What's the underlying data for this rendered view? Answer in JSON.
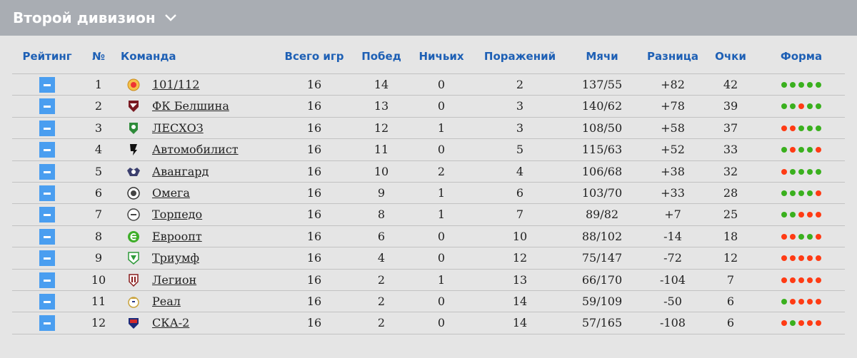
{
  "header": {
    "title": "Второй дивизион"
  },
  "columns": {
    "rating": "Рейтинг",
    "num": "№",
    "team": "Команда",
    "games": "Всего игр",
    "wins": "Побед",
    "draws": "Ничьих",
    "losses": "Поражений",
    "goals": "Мячи",
    "diff": "Разница",
    "points": "Очки",
    "form": "Форма"
  },
  "colors": {
    "win": "#3ab01e",
    "loss": "#ff3b14",
    "accent": "#1e60b5"
  },
  "rows": [
    {
      "num": "1",
      "team": "101/112",
      "logo": "logo-101-112",
      "games": "16",
      "wins": "14",
      "draws": "0",
      "losses": "2",
      "goals": "137/55",
      "diff": "+82",
      "points": "42",
      "form": [
        "w",
        "w",
        "w",
        "w",
        "w"
      ]
    },
    {
      "num": "2",
      "team": "ФК Белшина",
      "logo": "logo-belshina",
      "games": "16",
      "wins": "13",
      "draws": "0",
      "losses": "3",
      "goals": "140/62",
      "diff": "+78",
      "points": "39",
      "form": [
        "w",
        "w",
        "l",
        "w",
        "w"
      ]
    },
    {
      "num": "3",
      "team": "ЛЕСХОЗ",
      "logo": "logo-leskhoz",
      "games": "16",
      "wins": "12",
      "draws": "1",
      "losses": "3",
      "goals": "108/50",
      "diff": "+58",
      "points": "37",
      "form": [
        "l",
        "l",
        "w",
        "w",
        "w"
      ]
    },
    {
      "num": "4",
      "team": "Автомобилист",
      "logo": "logo-avtomobilist",
      "games": "16",
      "wins": "11",
      "draws": "0",
      "losses": "5",
      "goals": "115/63",
      "diff": "+52",
      "points": "33",
      "form": [
        "w",
        "l",
        "w",
        "w",
        "l"
      ]
    },
    {
      "num": "5",
      "team": "Авангард",
      "logo": "logo-avangard",
      "games": "16",
      "wins": "10",
      "draws": "2",
      "losses": "4",
      "goals": "106/68",
      "diff": "+38",
      "points": "32",
      "form": [
        "l",
        "w",
        "w",
        "w",
        "w"
      ]
    },
    {
      "num": "6",
      "team": "Омега",
      "logo": "logo-omega",
      "games": "16",
      "wins": "9",
      "draws": "1",
      "losses": "6",
      "goals": "103/70",
      "diff": "+33",
      "points": "28",
      "form": [
        "w",
        "w",
        "w",
        "w",
        "l"
      ]
    },
    {
      "num": "7",
      "team": "Торпедо",
      "logo": "logo-torpedo",
      "games": "16",
      "wins": "8",
      "draws": "1",
      "losses": "7",
      "goals": "89/82",
      "diff": "+7",
      "points": "25",
      "form": [
        "w",
        "w",
        "l",
        "l",
        "l"
      ]
    },
    {
      "num": "8",
      "team": "Евроопт",
      "logo": "logo-evroopt",
      "games": "16",
      "wins": "6",
      "draws": "0",
      "losses": "10",
      "goals": "88/102",
      "diff": "-14",
      "points": "18",
      "form": [
        "l",
        "l",
        "w",
        "w",
        "l"
      ]
    },
    {
      "num": "9",
      "team": "Триумф",
      "logo": "logo-triumf",
      "games": "16",
      "wins": "4",
      "draws": "0",
      "losses": "12",
      "goals": "75/147",
      "diff": "-72",
      "points": "12",
      "form": [
        "l",
        "l",
        "l",
        "l",
        "l"
      ]
    },
    {
      "num": "10",
      "team": "Легион",
      "logo": "logo-legion",
      "games": "16",
      "wins": "2",
      "draws": "1",
      "losses": "13",
      "goals": "66/170",
      "diff": "-104",
      "points": "7",
      "form": [
        "l",
        "l",
        "l",
        "l",
        "l"
      ]
    },
    {
      "num": "11",
      "team": "Реал",
      "logo": "logo-real",
      "games": "16",
      "wins": "2",
      "draws": "0",
      "losses": "14",
      "goals": "59/109",
      "diff": "-50",
      "points": "6",
      "form": [
        "w",
        "l",
        "l",
        "l",
        "l"
      ]
    },
    {
      "num": "12",
      "team": "СКА-2",
      "logo": "logo-ska-2",
      "games": "16",
      "wins": "2",
      "draws": "0",
      "losses": "14",
      "goals": "57/165",
      "diff": "-108",
      "points": "6",
      "form": [
        "l",
        "w",
        "l",
        "l",
        "l"
      ]
    }
  ]
}
